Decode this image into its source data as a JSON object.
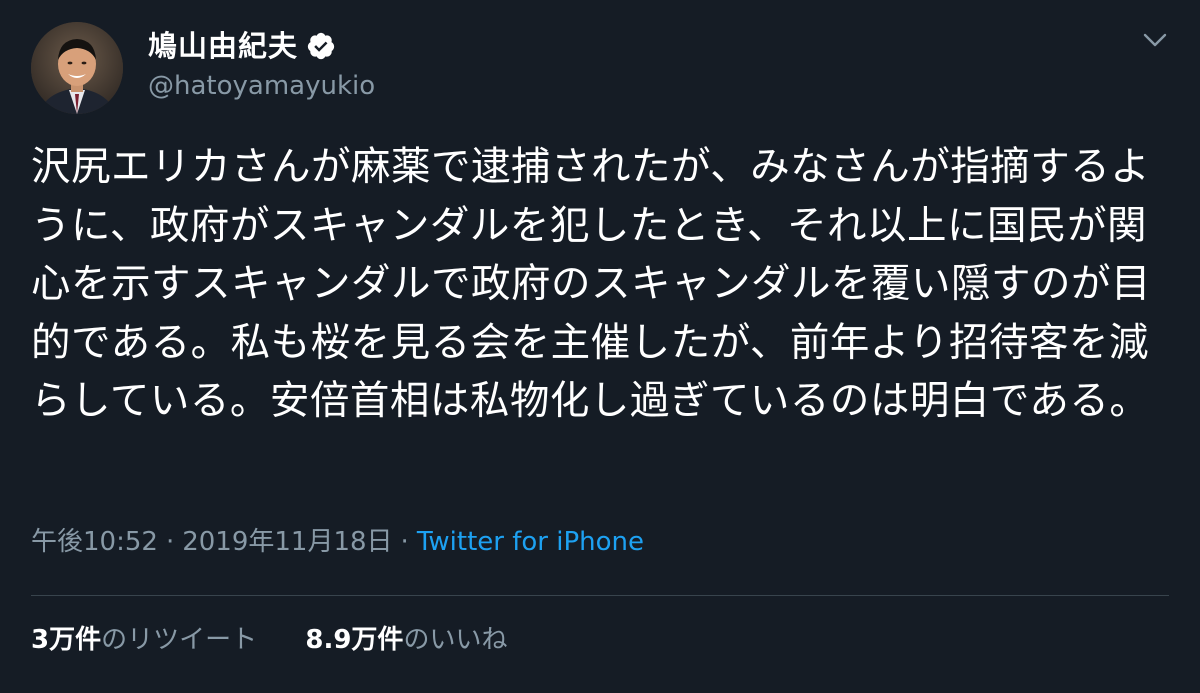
{
  "author": {
    "display_name": "鳩山由紀夫",
    "handle": "@hatoyamayukio",
    "verified": true,
    "avatar_icon": "avatar-photo"
  },
  "tweet": {
    "text": "沢尻エリカさんが麻薬で逮捕されたが、みなさんが指摘するように、政府がスキャンダルを犯したとき、それ以上に国民が関心を示すスキャンダルで政府のスキャンダルを覆い隠すのが目的である。私も桜を見る会を主催したが、前年より招待客を減らしている。安倍首相は私物化し過ぎているのは明白である。",
    "time": "午後10:52",
    "date": "2019年11月18日",
    "separator": "·",
    "source": "Twitter for iPhone"
  },
  "stats": {
    "retweets_count": "3万件",
    "retweets_label": "のリツイート",
    "likes_count": "8.9万件",
    "likes_label": "のいいね"
  },
  "icons": {
    "verified": "verified-badge-icon",
    "menu": "chevron-down-icon"
  },
  "colors": {
    "background": "#151c25",
    "text_primary": "#ffffff",
    "text_secondary": "#8899a6",
    "link": "#1da1f2",
    "divider": "#38444d"
  }
}
